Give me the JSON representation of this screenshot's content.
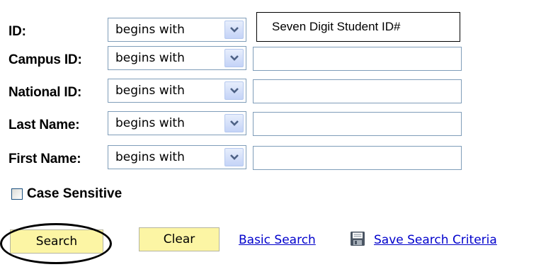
{
  "criteria": [
    {
      "label": "ID:",
      "operator": "begins with",
      "value": "Seven Digit Student ID#"
    },
    {
      "label": "Campus ID:",
      "operator": "begins with",
      "value": ""
    },
    {
      "label": "National ID:",
      "operator": "begins with",
      "value": ""
    },
    {
      "label": "Last Name:",
      "operator": "begins with",
      "value": ""
    },
    {
      "label": "First Name:",
      "operator": "begins with",
      "value": ""
    }
  ],
  "case_sensitive": {
    "label": "Case Sensitive",
    "checked": false
  },
  "buttons": {
    "search": "Search",
    "clear": "Clear"
  },
  "links": {
    "basic_search": "Basic Search",
    "save_search_criteria": "Save Search Criteria"
  },
  "icons": {
    "dropdown": "chevron-down-icon",
    "save": "floppy-disk-icon"
  },
  "colors": {
    "button_background": "#fcf5a4",
    "link": "#0000cc",
    "field_border": "#7f9db9",
    "dropdown_button": "#c4d3f7",
    "dropdown_arrow": "#4d6185"
  }
}
